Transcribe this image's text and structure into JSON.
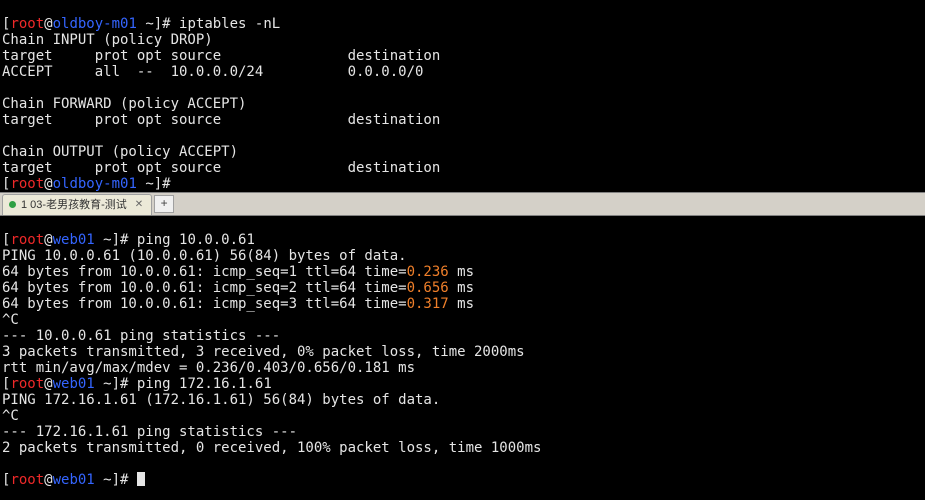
{
  "top": {
    "prompt": {
      "user": "root",
      "at": "@",
      "host": "oldboy-m01",
      "path": " ~",
      "hash": "]#"
    },
    "cmd1": " iptables -nL",
    "inputChain": "Chain INPUT (policy DROP)",
    "header": "target     prot opt source               destination",
    "inputRule": "ACCEPT     all  --  10.0.0.0/24          0.0.0.0/0",
    "forwardChain": "Chain FORWARD (policy ACCEPT)",
    "outputChain": "Chain OUTPUT (policy ACCEPT)"
  },
  "tab": {
    "label": "1 03-老男孩教育-测试"
  },
  "bottom": {
    "prompt": {
      "user": "root",
      "at": "@",
      "host": "web01",
      "path": " ~",
      "hash": "]#"
    },
    "cmd1": " ping 10.0.0.61",
    "pingHead": "PING 10.0.0.61 (10.0.0.61) 56(84) bytes of data.",
    "r1a": "64 bytes from 10.0.0.61: icmp_seq=1 ttl=64 time=",
    "r1b": "0.236",
    "r1c": " ms",
    "r2a": "64 bytes from 10.0.0.61: icmp_seq=2 ttl=64 time=",
    "r2b": "0.656",
    "r2c": " ms",
    "r3a": "64 bytes from 10.0.0.61: icmp_seq=3 ttl=64 time=",
    "r3b": "0.317",
    "r3c": " ms",
    "ctrl": "^C",
    "stat1": "--- 10.0.0.61 ping statistics ---",
    "sum1": "3 packets transmitted, 3 received, 0% packet loss, time 2000ms",
    "rtt": "rtt min/avg/max/mdev = 0.236/0.403/0.656/0.181 ms",
    "cmd2": " ping 172.16.1.61",
    "pingHead2": "PING 172.16.1.61 (172.16.1.61) 56(84) bytes of data.",
    "stat2": "--- 172.16.1.61 ping statistics ---",
    "sum2": "2 packets transmitted, 0 received, 100% packet loss, time 1000ms",
    "blank": ""
  }
}
